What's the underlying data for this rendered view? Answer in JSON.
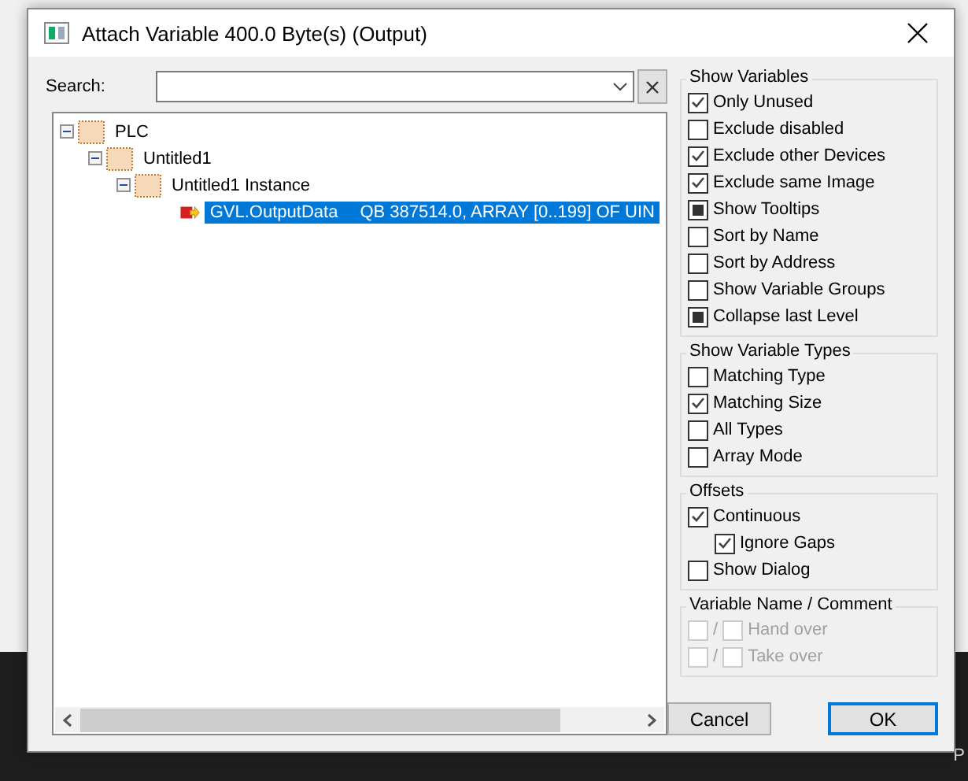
{
  "background": {
    "corner_text": "P"
  },
  "window": {
    "title": "Attach Variable 400.0 Byte(s) (Output)"
  },
  "search": {
    "label": "Search:"
  },
  "tree": [
    {
      "label": "PLC",
      "expanded": true,
      "selected": false,
      "kind": "folder",
      "children": [
        {
          "label": "Untitled1",
          "expanded": true,
          "selected": false,
          "kind": "folder",
          "children": [
            {
              "label": "Untitled1 Instance",
              "expanded": true,
              "selected": false,
              "kind": "folder",
              "children": [
                {
                  "label": "GVL.OutputData",
                  "detail": "QB 387514.0, ARRAY [0..199] OF UIN",
                  "selected": true,
                  "kind": "variable"
                }
              ]
            }
          ]
        }
      ]
    }
  ],
  "groups": [
    {
      "title": "Show Variables",
      "options": [
        {
          "label": "Only Unused",
          "kind": "checkbox",
          "checked": true,
          "indent": false
        },
        {
          "label": "Exclude disabled",
          "kind": "checkbox",
          "checked": false,
          "indent": false
        },
        {
          "label": "Exclude other Devices",
          "kind": "checkbox",
          "checked": true,
          "indent": false
        },
        {
          "label": "Exclude same Image",
          "kind": "checkbox",
          "checked": true,
          "indent": false
        },
        {
          "label": "Show Tooltips",
          "kind": "tristate",
          "checked": true,
          "indent": false
        },
        {
          "label": "Sort by Name",
          "kind": "checkbox",
          "checked": false,
          "indent": false
        },
        {
          "label": "Sort by Address",
          "kind": "checkbox",
          "checked": false,
          "indent": false
        },
        {
          "label": "Show Variable Groups",
          "kind": "checkbox",
          "checked": false,
          "indent": false
        },
        {
          "label": "Collapse last Level",
          "kind": "tristate",
          "checked": true,
          "indent": false
        }
      ]
    },
    {
      "title": "Show Variable Types",
      "options": [
        {
          "label": "Matching Type",
          "kind": "checkbox",
          "checked": false,
          "indent": false
        },
        {
          "label": "Matching Size",
          "kind": "checkbox",
          "checked": true,
          "indent": false
        },
        {
          "label": "All Types",
          "kind": "checkbox",
          "checked": false,
          "indent": false
        },
        {
          "label": "Array Mode",
          "kind": "checkbox",
          "checked": false,
          "indent": false
        }
      ]
    },
    {
      "title": "Offsets",
      "options": [
        {
          "label": "Continuous",
          "kind": "checkbox",
          "checked": true,
          "indent": false
        },
        {
          "label": "Ignore Gaps",
          "kind": "checkbox",
          "checked": true,
          "indent": true
        },
        {
          "label": "Show Dialog",
          "kind": "checkbox",
          "checked": false,
          "indent": false
        }
      ]
    }
  ],
  "name_comment": {
    "title": "Variable Name / Comment",
    "rows": [
      {
        "separator": "/",
        "label": "Hand over",
        "disabled": true
      },
      {
        "separator": "/",
        "label": "Take over",
        "disabled": true
      }
    ]
  },
  "buttons": [
    {
      "label": "Cancel",
      "default": false
    },
    {
      "label": "OK",
      "default": true
    }
  ]
}
